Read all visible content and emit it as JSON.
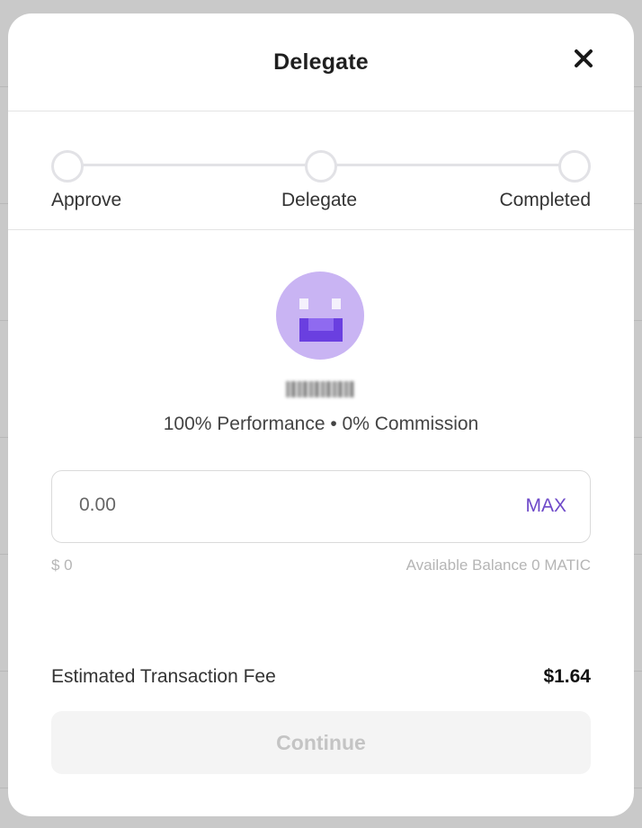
{
  "modal": {
    "title": "Delegate",
    "close_icon": "close-icon"
  },
  "steps": [
    {
      "label": "Approve"
    },
    {
      "label": "Delegate"
    },
    {
      "label": "Completed"
    }
  ],
  "validator": {
    "avatar_icon": "pixel-smiley-avatar",
    "stats": "100% Performance • 0% Commission"
  },
  "amount": {
    "placeholder": "0.00",
    "max_label": "MAX",
    "usd_value": "$ 0",
    "balance_text": "Available Balance 0 MATIC"
  },
  "fee": {
    "label": "Estimated Transaction Fee",
    "value": "$1.64"
  },
  "continue_label": "Continue",
  "colors": {
    "accent": "#6e49c9",
    "avatar_bg": "#c9b4f3",
    "disabled_text": "#c4c4c4"
  }
}
